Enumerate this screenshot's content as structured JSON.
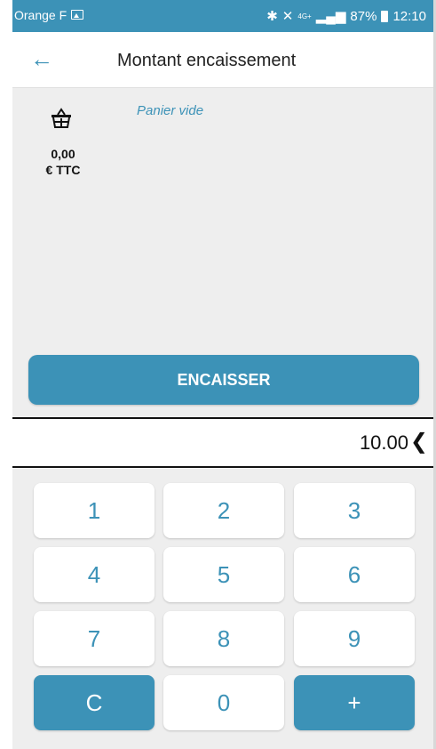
{
  "status_bar": {
    "carrier": "Orange F",
    "network": "4G+",
    "battery": "87%",
    "time": "12:10"
  },
  "app_bar": {
    "title": "Montant encaissement"
  },
  "cart": {
    "empty_label": "Panier vide",
    "total_amount": "0,00",
    "total_unit": "€ TTC"
  },
  "encaisser_label": "ENCAISSER",
  "amount_display": "10.00",
  "keypad": {
    "k1": "1",
    "k2": "2",
    "k3": "3",
    "k4": "4",
    "k5": "5",
    "k6": "6",
    "k7": "7",
    "k8": "8",
    "k9": "9",
    "clear": "C",
    "k0": "0",
    "plus": "+"
  },
  "colors": {
    "accent": "#3c92b7",
    "background": "#eeeeee"
  }
}
